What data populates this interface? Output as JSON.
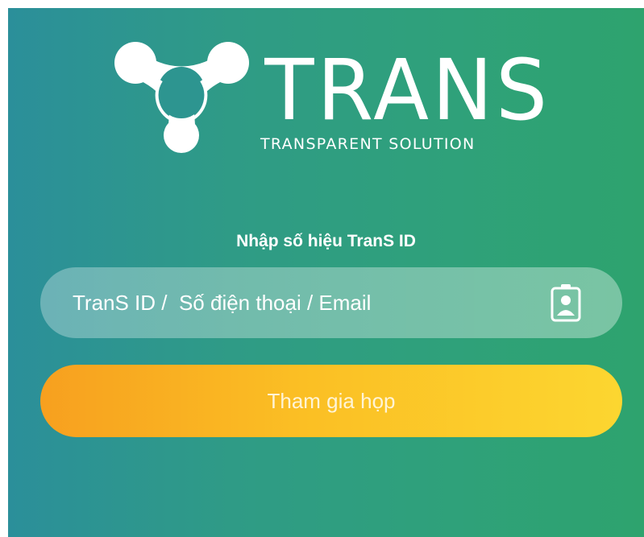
{
  "brand": {
    "name": "TRANS",
    "tagline": "TRANSPARENT SOLUTION",
    "logo_icon": "trans-y-logo-icon"
  },
  "login": {
    "prompt": "Nhập số hiệu TranS ID",
    "id_field": {
      "placeholder": "TranS ID /  Số điện thoại / Email",
      "value": "",
      "icon": "id-badge-icon"
    },
    "join_label": "Tham gia họp"
  },
  "colors": {
    "background_start": "#2b8f9a",
    "background_end": "#2ea36e",
    "button_start": "#f7a01f",
    "button_end": "#fcd630",
    "text": "#ffffff"
  }
}
